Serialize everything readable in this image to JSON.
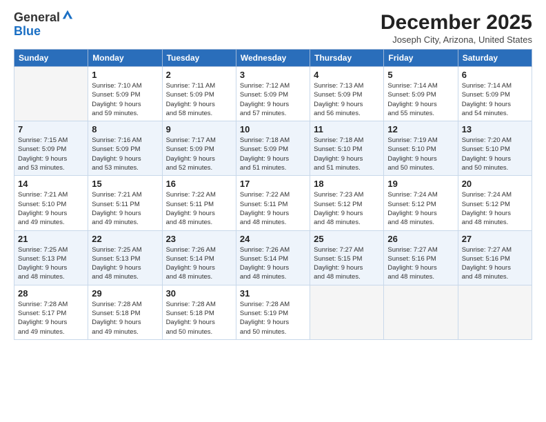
{
  "header": {
    "logo_general": "General",
    "logo_blue": "Blue",
    "month_title": "December 2025",
    "location": "Joseph City, Arizona, United States"
  },
  "days_of_week": [
    "Sunday",
    "Monday",
    "Tuesday",
    "Wednesday",
    "Thursday",
    "Friday",
    "Saturday"
  ],
  "weeks": [
    [
      {
        "day": "",
        "info": ""
      },
      {
        "day": "1",
        "info": "Sunrise: 7:10 AM\nSunset: 5:09 PM\nDaylight: 9 hours\nand 59 minutes."
      },
      {
        "day": "2",
        "info": "Sunrise: 7:11 AM\nSunset: 5:09 PM\nDaylight: 9 hours\nand 58 minutes."
      },
      {
        "day": "3",
        "info": "Sunrise: 7:12 AM\nSunset: 5:09 PM\nDaylight: 9 hours\nand 57 minutes."
      },
      {
        "day": "4",
        "info": "Sunrise: 7:13 AM\nSunset: 5:09 PM\nDaylight: 9 hours\nand 56 minutes."
      },
      {
        "day": "5",
        "info": "Sunrise: 7:14 AM\nSunset: 5:09 PM\nDaylight: 9 hours\nand 55 minutes."
      },
      {
        "day": "6",
        "info": "Sunrise: 7:14 AM\nSunset: 5:09 PM\nDaylight: 9 hours\nand 54 minutes."
      }
    ],
    [
      {
        "day": "7",
        "info": "Sunrise: 7:15 AM\nSunset: 5:09 PM\nDaylight: 9 hours\nand 53 minutes."
      },
      {
        "day": "8",
        "info": "Sunrise: 7:16 AM\nSunset: 5:09 PM\nDaylight: 9 hours\nand 53 minutes."
      },
      {
        "day": "9",
        "info": "Sunrise: 7:17 AM\nSunset: 5:09 PM\nDaylight: 9 hours\nand 52 minutes."
      },
      {
        "day": "10",
        "info": "Sunrise: 7:18 AM\nSunset: 5:09 PM\nDaylight: 9 hours\nand 51 minutes."
      },
      {
        "day": "11",
        "info": "Sunrise: 7:18 AM\nSunset: 5:10 PM\nDaylight: 9 hours\nand 51 minutes."
      },
      {
        "day": "12",
        "info": "Sunrise: 7:19 AM\nSunset: 5:10 PM\nDaylight: 9 hours\nand 50 minutes."
      },
      {
        "day": "13",
        "info": "Sunrise: 7:20 AM\nSunset: 5:10 PM\nDaylight: 9 hours\nand 50 minutes."
      }
    ],
    [
      {
        "day": "14",
        "info": "Sunrise: 7:21 AM\nSunset: 5:10 PM\nDaylight: 9 hours\nand 49 minutes."
      },
      {
        "day": "15",
        "info": "Sunrise: 7:21 AM\nSunset: 5:11 PM\nDaylight: 9 hours\nand 49 minutes."
      },
      {
        "day": "16",
        "info": "Sunrise: 7:22 AM\nSunset: 5:11 PM\nDaylight: 9 hours\nand 48 minutes."
      },
      {
        "day": "17",
        "info": "Sunrise: 7:22 AM\nSunset: 5:11 PM\nDaylight: 9 hours\nand 48 minutes."
      },
      {
        "day": "18",
        "info": "Sunrise: 7:23 AM\nSunset: 5:12 PM\nDaylight: 9 hours\nand 48 minutes."
      },
      {
        "day": "19",
        "info": "Sunrise: 7:24 AM\nSunset: 5:12 PM\nDaylight: 9 hours\nand 48 minutes."
      },
      {
        "day": "20",
        "info": "Sunrise: 7:24 AM\nSunset: 5:12 PM\nDaylight: 9 hours\nand 48 minutes."
      }
    ],
    [
      {
        "day": "21",
        "info": "Sunrise: 7:25 AM\nSunset: 5:13 PM\nDaylight: 9 hours\nand 48 minutes."
      },
      {
        "day": "22",
        "info": "Sunrise: 7:25 AM\nSunset: 5:13 PM\nDaylight: 9 hours\nand 48 minutes."
      },
      {
        "day": "23",
        "info": "Sunrise: 7:26 AM\nSunset: 5:14 PM\nDaylight: 9 hours\nand 48 minutes."
      },
      {
        "day": "24",
        "info": "Sunrise: 7:26 AM\nSunset: 5:14 PM\nDaylight: 9 hours\nand 48 minutes."
      },
      {
        "day": "25",
        "info": "Sunrise: 7:27 AM\nSunset: 5:15 PM\nDaylight: 9 hours\nand 48 minutes."
      },
      {
        "day": "26",
        "info": "Sunrise: 7:27 AM\nSunset: 5:16 PM\nDaylight: 9 hours\nand 48 minutes."
      },
      {
        "day": "27",
        "info": "Sunrise: 7:27 AM\nSunset: 5:16 PM\nDaylight: 9 hours\nand 48 minutes."
      }
    ],
    [
      {
        "day": "28",
        "info": "Sunrise: 7:28 AM\nSunset: 5:17 PM\nDaylight: 9 hours\nand 49 minutes."
      },
      {
        "day": "29",
        "info": "Sunrise: 7:28 AM\nSunset: 5:18 PM\nDaylight: 9 hours\nand 49 minutes."
      },
      {
        "day": "30",
        "info": "Sunrise: 7:28 AM\nSunset: 5:18 PM\nDaylight: 9 hours\nand 50 minutes."
      },
      {
        "day": "31",
        "info": "Sunrise: 7:28 AM\nSunset: 5:19 PM\nDaylight: 9 hours\nand 50 minutes."
      },
      {
        "day": "",
        "info": ""
      },
      {
        "day": "",
        "info": ""
      },
      {
        "day": "",
        "info": ""
      }
    ]
  ]
}
